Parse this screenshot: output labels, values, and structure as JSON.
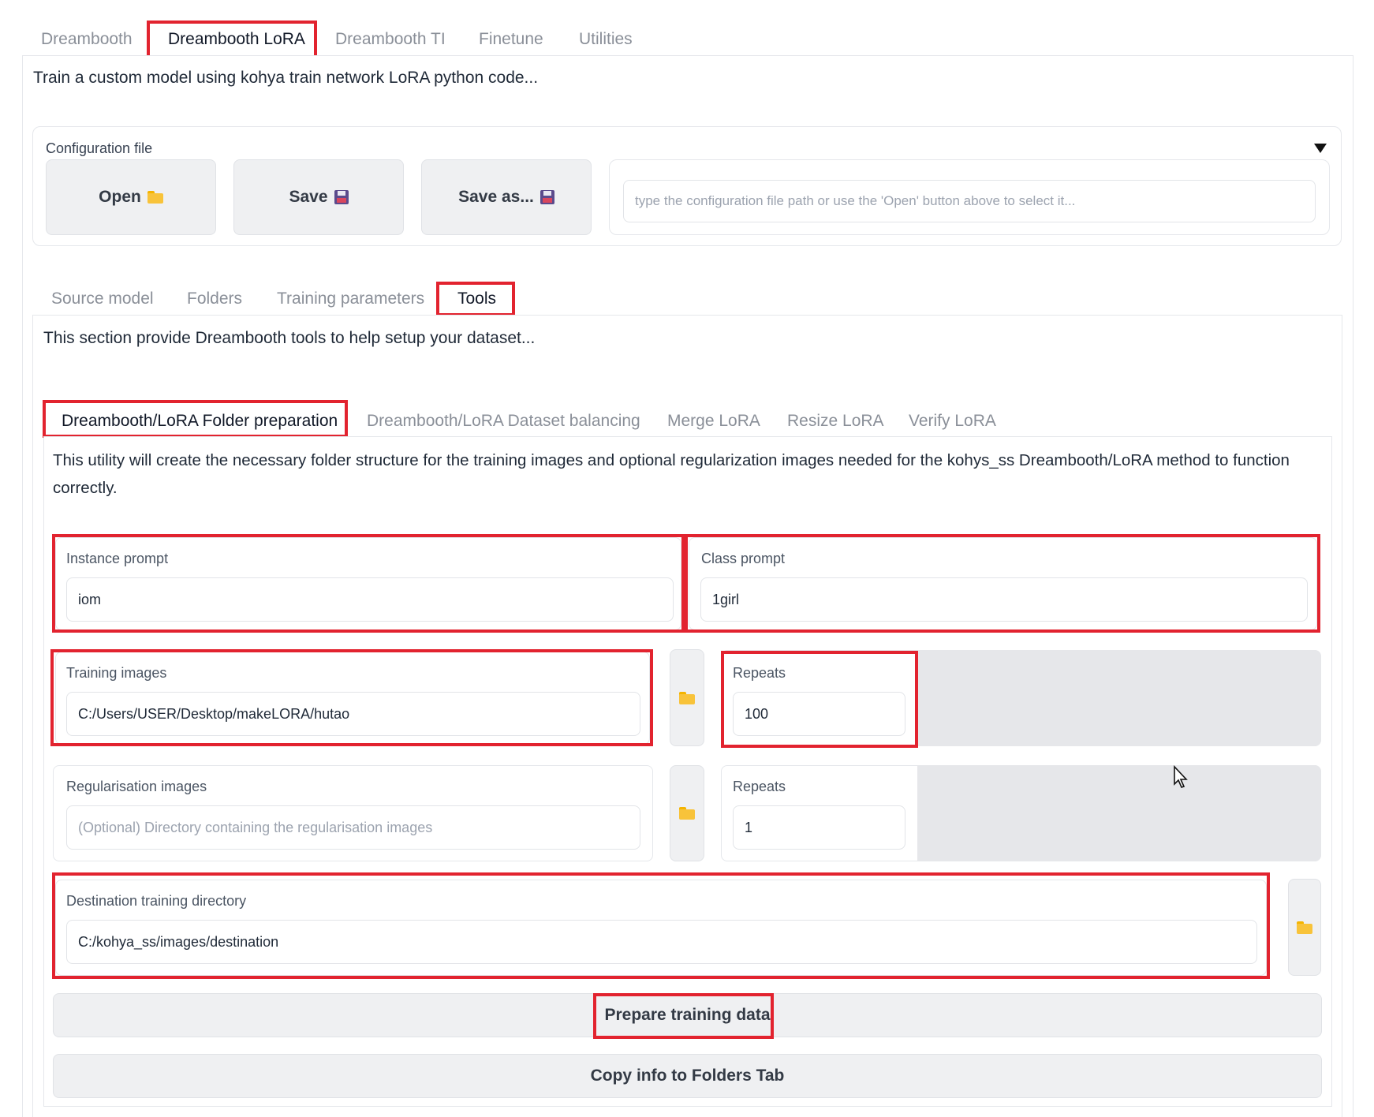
{
  "top_tabs": [
    {
      "label": "Dreambooth"
    },
    {
      "label": "Dreambooth LoRA"
    },
    {
      "label": "Dreambooth TI"
    },
    {
      "label": "Finetune"
    },
    {
      "label": "Utilities"
    }
  ],
  "main": {
    "description": "Train a custom model using kohya train network LoRA python code..."
  },
  "config": {
    "label": "Configuration file",
    "open_label": "Open",
    "save_label": "Save",
    "save_as_label": "Save as...",
    "path_placeholder": "type the configuration file path or use the 'Open' button above to select it..."
  },
  "section_tabs": [
    {
      "label": "Source model"
    },
    {
      "label": "Folders"
    },
    {
      "label": "Training parameters"
    },
    {
      "label": "Tools"
    }
  ],
  "tools": {
    "description": "This section provide Dreambooth tools to help setup your dataset...",
    "tabs": [
      {
        "label": "Dreambooth/LoRA Folder preparation"
      },
      {
        "label": "Dreambooth/LoRA Dataset balancing"
      },
      {
        "label": "Merge LoRA"
      },
      {
        "label": "Resize LoRA"
      },
      {
        "label": "Verify LoRA"
      }
    ]
  },
  "prep": {
    "description_line1": "This utility will create the necessary folder structure for the training images and optional regularization images needed for the kohys_ss Dreambooth/LoRA method to function",
    "description_line2": "correctly.",
    "instance_prompt": {
      "label": "Instance prompt",
      "value": "iom"
    },
    "class_prompt": {
      "label": "Class prompt",
      "value": "1girl"
    },
    "training_images": {
      "label": "Training images",
      "value": "C:/Users/USER/Desktop/makeLORA/hutao"
    },
    "training_repeats": {
      "label": "Repeats",
      "value": "100"
    },
    "reg_images": {
      "label": "Regularisation images",
      "placeholder": "(Optional) Directory containing the regularisation images"
    },
    "reg_repeats": {
      "label": "Repeats",
      "value": "1"
    },
    "destination": {
      "label": "Destination training directory",
      "value": "C:/kohya_ss/images/destination"
    },
    "prepare_button": "Prepare training data",
    "copy_button": "Copy info to Folders Tab"
  },
  "colors": {
    "highlight": "#e2232f",
    "folder_icon": "#f8c33a"
  }
}
